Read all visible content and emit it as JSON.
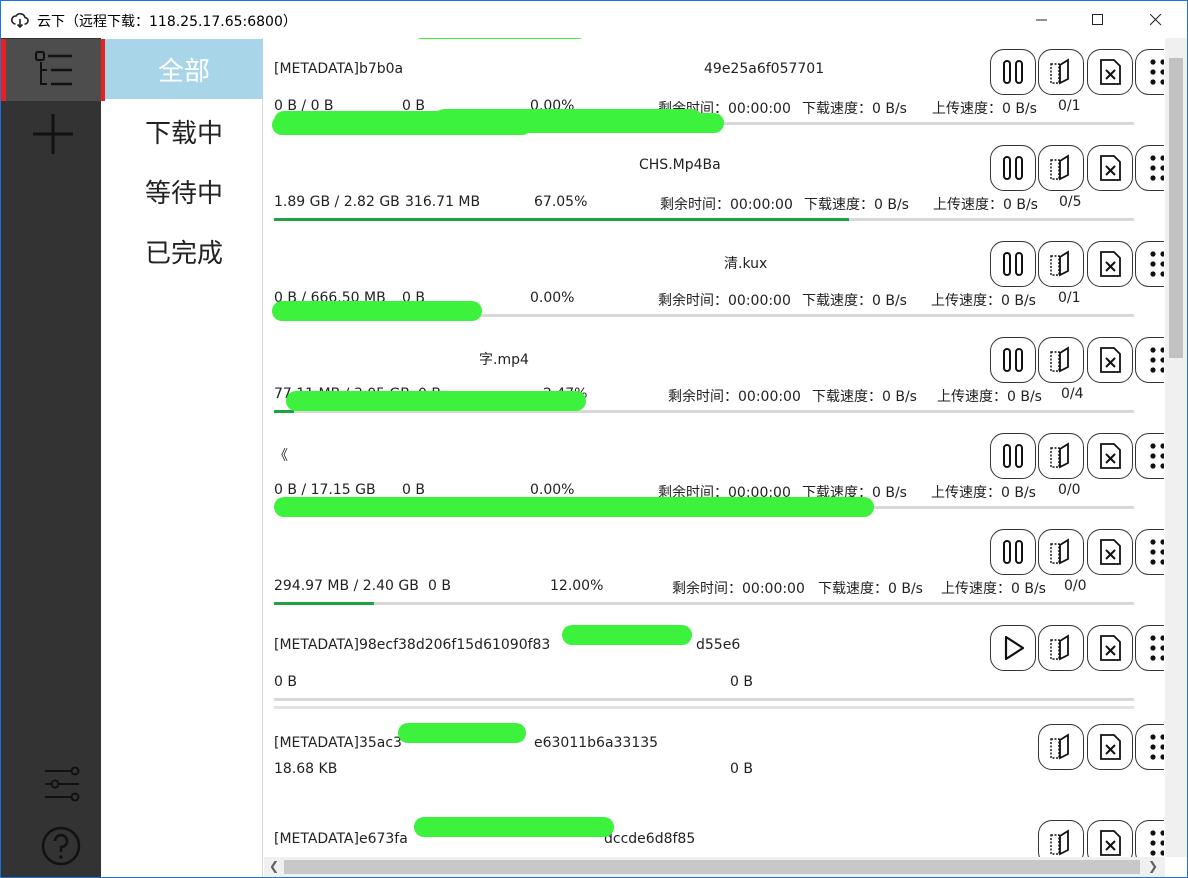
{
  "window": {
    "title": "云下（远程下载：118.25.17.65:6800）",
    "controls": [
      "minimize",
      "maximize",
      "close"
    ]
  },
  "sidebar": {
    "icons": [
      "list-icon",
      "plus-icon",
      "settings-sliders-icon",
      "help-icon"
    ]
  },
  "nav": {
    "items": [
      {
        "label": "全部",
        "active": true
      },
      {
        "label": "下载中",
        "active": false
      },
      {
        "label": "等待中",
        "active": false
      },
      {
        "label": "已完成",
        "active": false
      }
    ]
  },
  "tasks": [
    {
      "name": "[METADATA]b7b0a…49e25a6f057701",
      "name_parts": [
        "[METADATA]b7b0a",
        "49e25a6f057701"
      ],
      "size": "0 B / 0 B",
      "speed": "0 B",
      "percent": "0.00%",
      "progress": 0,
      "remaining": "剩余时间：00:00:00",
      "download_speed": "下载速度：0 B/s",
      "upload_speed": "上传速度：0 B/s",
      "connections": "0/1",
      "state": "active"
    },
    {
      "name_parts": [
        "",
        "CHS.Mp4Ba"
      ],
      "size": "1.89 GB / 2.82 GB",
      "speed": "316.71 MB",
      "percent": "67.05%",
      "progress": 0.6705,
      "remaining": "剩余时间：00:00:00",
      "download_speed": "下载速度：0 B/s",
      "upload_speed": "上传速度：0 B/s",
      "connections": "0/5",
      "state": "active"
    },
    {
      "name_parts": [
        "",
        "清.kux"
      ],
      "size": "0 B / 666.50 MB",
      "speed": "0 B",
      "percent": "0.00%",
      "progress": 0,
      "remaining": "剩余时间：00:00:00",
      "download_speed": "下载速度：0 B/s",
      "upload_speed": "上传速度：0 B/s",
      "connections": "0/1",
      "state": "active"
    },
    {
      "name_parts": [
        "",
        "字.mp4"
      ],
      "size": "77.11 MB / 3.05 GB",
      "speed": "0 B",
      "percent": "2.47%",
      "progress": 0.0247,
      "remaining": "剩余时间：00:00:00",
      "download_speed": "下载速度：0 B/s",
      "upload_speed": "上传速度：0 B/s",
      "connections": "0/4",
      "state": "active"
    },
    {
      "name_parts": [
        "《",
        ""
      ],
      "size": "0 B / 17.15 GB",
      "speed": "0 B",
      "percent": "0.00%",
      "progress": 0,
      "remaining": "剩余时间：00:00:00",
      "download_speed": "下载速度：0 B/s",
      "upload_speed": "上传速度：0 B/s",
      "connections": "0/0",
      "state": "active"
    },
    {
      "name_parts": [
        "",
        ""
      ],
      "size": "294.97 MB / 2.40 GB",
      "speed": "0 B",
      "percent": "12.00%",
      "progress": 0.12,
      "remaining": "剩余时间：00:00:00",
      "download_speed": "下载速度：0 B/s",
      "upload_speed": "上传速度：0 B/s",
      "connections": "0/0",
      "state": "active"
    },
    {
      "name_parts": [
        "[METADATA]98ecf38d206f15d61090f83",
        "d55e6"
      ],
      "size": "0 B",
      "speed": "0 B",
      "state": "paused"
    },
    {
      "name_parts": [
        "[METADATA]35ac3",
        "e63011b6a33135"
      ],
      "size": "18.68 KB",
      "speed": "0 B",
      "state": "complete"
    },
    {
      "name_parts": [
        "[METADATA]e673fa",
        "dccde6d8f85"
      ],
      "state": "complete"
    }
  ],
  "colors": {
    "accent_red": "#e82020",
    "progress_green": "#21a145",
    "nav_active": "#a9d5e8",
    "sidebar_bg": "#333333",
    "redaction": "#3df23d"
  }
}
